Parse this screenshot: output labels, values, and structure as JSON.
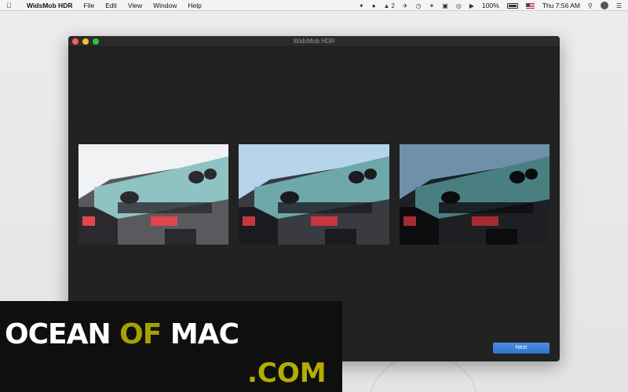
{
  "menubar": {
    "apple_icon": "apple-icon",
    "app_name": "WidsMob HDR",
    "menus": [
      "File",
      "Edit",
      "View",
      "Window",
      "Help"
    ],
    "badge_count": "2",
    "battery": "100%",
    "clock": "Thu 7:56 AM"
  },
  "window": {
    "title": "WidsMob HDR",
    "next_label": "Next",
    "photos": [
      {
        "exposure": "overexposed"
      },
      {
        "exposure": "normal"
      },
      {
        "exposure": "underexposed"
      }
    ]
  },
  "watermark": {
    "part1": "OCEAN ",
    "part2": "OF",
    "part3": " MAC",
    "line2": ".COM",
    "colors": {
      "white": "#ffffff",
      "olive": "#a6a000"
    }
  }
}
